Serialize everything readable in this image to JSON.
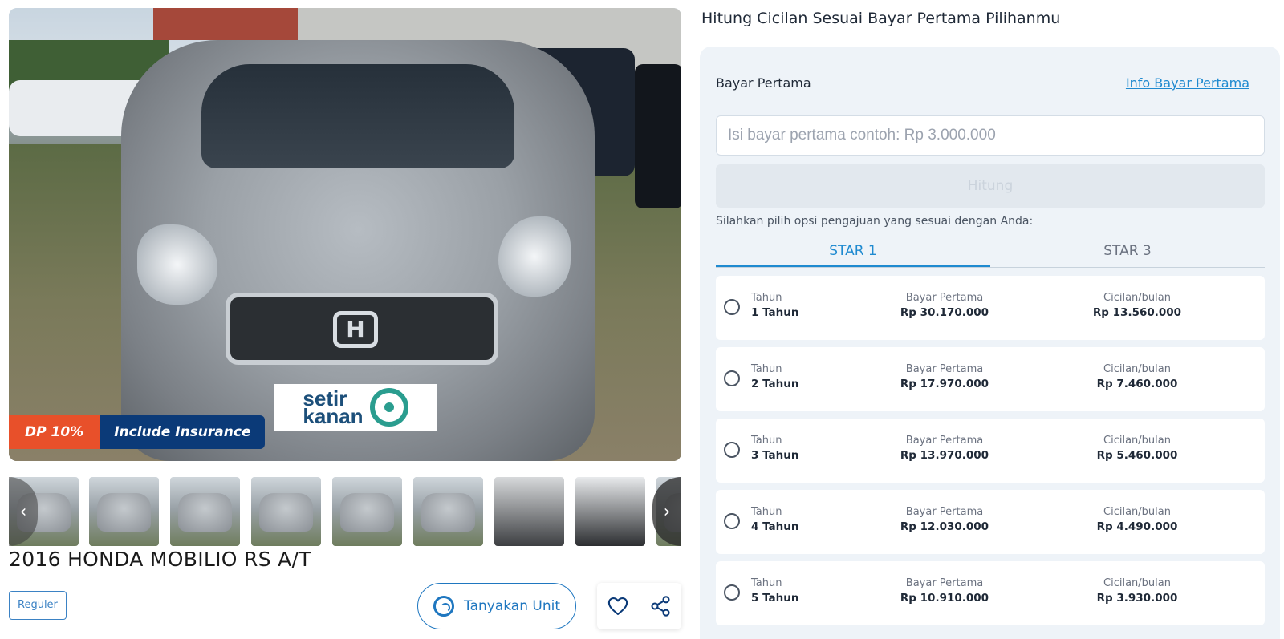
{
  "listing": {
    "promo_dp": "DP 10%",
    "promo_insurance": "Include Insurance",
    "plate_line1": "setir",
    "plate_line2": "kanan",
    "title": "2016 HONDA MOBILIO RS A/T",
    "tag": "Reguler",
    "ask_button": "Tanyakan Unit",
    "icons": {
      "whatsapp": "whatsapp-icon",
      "favorite": "heart-icon",
      "share": "share-icon",
      "prev": "chevron-left-icon",
      "next": "chevron-right-icon"
    }
  },
  "calculator": {
    "heading": "Hitung Cicilan Sesuai Bayar Pertama Pilihanmu",
    "bayar_label": "Bayar Pertama",
    "info_link": "Info Bayar Pertama",
    "input_placeholder": "Isi bayar pertama contoh: Rp 3.000.000",
    "button": "Hitung",
    "hint": "Silahkan pilih opsi pengajuan yang sesuai dengan Anda:",
    "tabs": [
      "STAR 1",
      "STAR 3"
    ],
    "active_tab": "STAR 1",
    "column_labels": {
      "tenor": "Tahun",
      "dp": "Bayar Pertama",
      "monthly": "Cicilan/bulan"
    },
    "options": [
      {
        "tenor": "1 Tahun",
        "dp": "Rp 30.170.000",
        "monthly": "Rp 13.560.000"
      },
      {
        "tenor": "2 Tahun",
        "dp": "Rp 17.970.000",
        "monthly": "Rp 7.460.000"
      },
      {
        "tenor": "3 Tahun",
        "dp": "Rp 13.970.000",
        "monthly": "Rp 5.460.000"
      },
      {
        "tenor": "4 Tahun",
        "dp": "Rp 12.030.000",
        "monthly": "Rp 4.490.000"
      },
      {
        "tenor": "5 Tahun",
        "dp": "Rp 10.910.000",
        "monthly": "Rp 3.930.000"
      }
    ]
  },
  "colors": {
    "accent": "#1f8ad0",
    "promo_orange": "#e8502a",
    "promo_navy": "#0b3a78",
    "panel_bg": "#eef3f8"
  }
}
